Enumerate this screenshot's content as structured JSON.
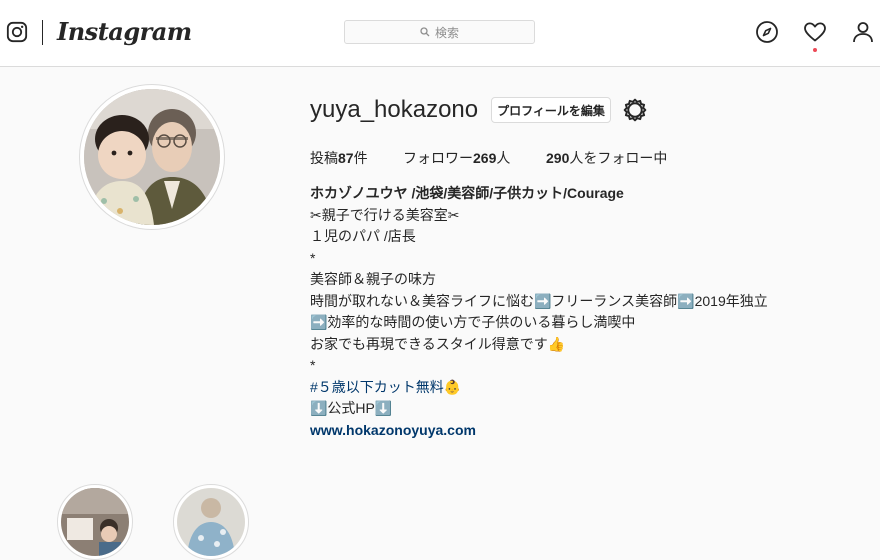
{
  "header": {
    "wordmark": "Instagram",
    "search_placeholder": "検索",
    "icons": [
      "instagram-glyph-icon",
      "search-icon",
      "compass-icon",
      "heart-icon",
      "person-icon"
    ],
    "notification_dot_color": "#ed4956"
  },
  "profile": {
    "username": "yuya_hokazono",
    "edit_button": "プロフィールを編集",
    "settings_icon": "gear-icon",
    "stats": {
      "posts_label": "投稿",
      "posts_count": "87",
      "posts_unit": "件",
      "followers_label": "フォロワー",
      "followers_count": "269",
      "followers_unit": "人",
      "following_count": "290",
      "following_label": "人をフォロー中"
    },
    "bio": {
      "name": "ホカゾノユウヤ /池袋/美容師/子供カット/Courage",
      "lines": [
        "✂︎親子で行ける美容室✂︎",
        "１児のパパ /店長",
        "*",
        "美容師＆親子の味方",
        "時間が取れない＆美容ライフに悩む➡️フリーランス美容師➡️2019年独立",
        "➡️効率的な時間の使い方で子供のいる暮らし満喫中",
        "お家でも再現できるスタイル得意です👍",
        "*"
      ],
      "hashtag": "#５歳以下カット無料👶",
      "link_label": "⬇️公式HP⬇️",
      "website": "www.hokazonoyuya.com"
    }
  },
  "highlights": [
    {
      "icon": "highlight-photo-1"
    },
    {
      "icon": "highlight-photo-2"
    }
  ]
}
